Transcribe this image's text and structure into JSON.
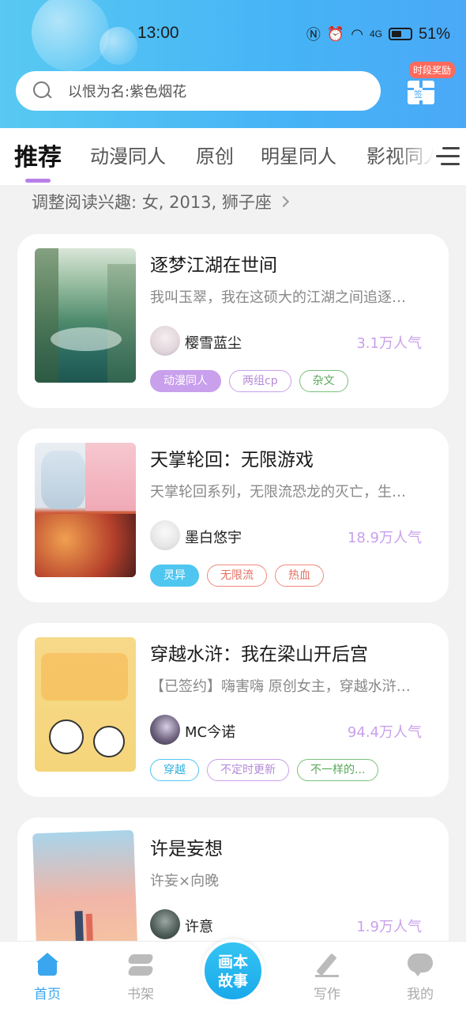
{
  "status_bar": {
    "time": "13:00",
    "battery": "51%",
    "network": "4G"
  },
  "search": {
    "placeholder": "以恨为名:紫色烟花"
  },
  "reward": {
    "badge": "时段奖励",
    "icon_text": "签"
  },
  "tabs": [
    {
      "label": "推荐",
      "active": true
    },
    {
      "label": "动漫同人"
    },
    {
      "label": "原创"
    },
    {
      "label": "明星同人"
    },
    {
      "label": "影视同人"
    }
  ],
  "interest": {
    "text": "调整阅读兴趣: 女, 2013, 狮子座"
  },
  "cards": [
    {
      "title": "逐梦江湖在世间",
      "desc": "我叫玉翠，我在这硕大的江湖之间追逐…",
      "author": "樱雪蓝尘",
      "popularity": "3.1万人气",
      "tags": [
        {
          "label": "动漫同人",
          "style": "filled",
          "color": "#c9a0ec"
        },
        {
          "label": "两组cp",
          "style": "outline",
          "color": "#c9a0ec"
        },
        {
          "label": "杂文",
          "style": "outline",
          "color": "#7ac07a"
        }
      ]
    },
    {
      "title": "天掌轮回：无限游戏",
      "desc": "天掌轮回系列，无限流恐龙的灭亡，生…",
      "author": "墨白悠宇",
      "popularity": "18.9万人气",
      "tags": [
        {
          "label": "灵异",
          "style": "filled",
          "color": "#4fc6ef"
        },
        {
          "label": "无限流",
          "style": "outline",
          "color": "#ef8a7e"
        },
        {
          "label": "热血",
          "style": "outline",
          "color": "#ef8a7e"
        }
      ]
    },
    {
      "title": "穿越水浒：我在梁山开后宫",
      "desc": "【已签约】嗨害嗨 原创女主，穿越水浒…",
      "author": "MC今诺",
      "popularity": "94.4万人气",
      "tags": [
        {
          "label": "穿越",
          "style": "outline",
          "color": "#4fc6ef"
        },
        {
          "label": "不定时更新",
          "style": "outline",
          "color": "#c9a0ec"
        },
        {
          "label": "不一样的...",
          "style": "outline",
          "color": "#7ac07a"
        }
      ]
    },
    {
      "title": "许是妄想",
      "desc": "许妄×向晚",
      "author": "许意",
      "popularity": "1.9万人气",
      "tags": []
    }
  ],
  "bottom_nav": {
    "home": "首页",
    "shelf": "书架",
    "center": "画本故事",
    "write": "写作",
    "mine": "我的"
  },
  "colors": {
    "accent": "#3aa6ee",
    "popularity": "#c9a0ec",
    "header": "#46b4f6"
  }
}
